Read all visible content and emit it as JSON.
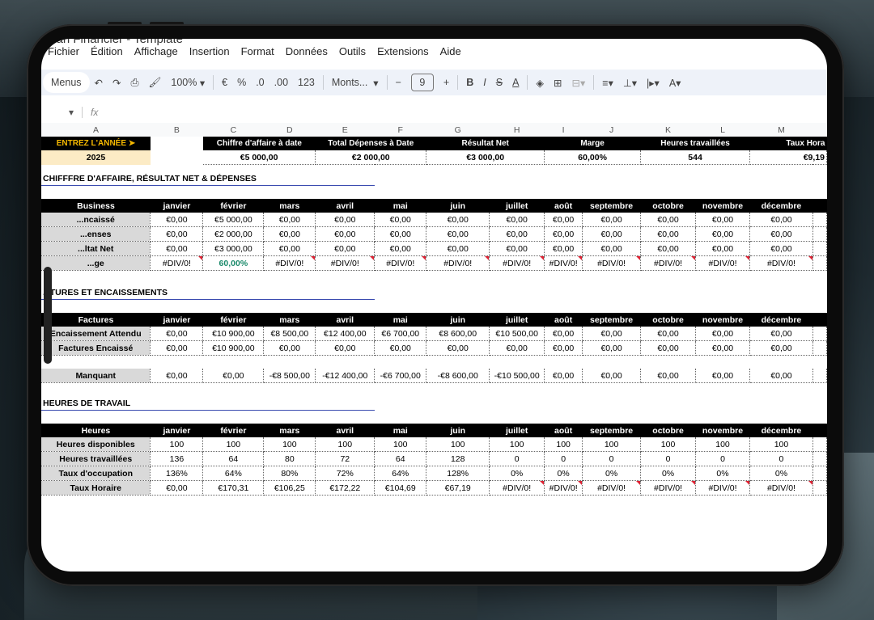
{
  "doc_title": "...an Financier - Template",
  "menu": [
    "Fichier",
    "Édition",
    "Affichage",
    "Insertion",
    "Format",
    "Données",
    "Outils",
    "Extensions",
    "Aide"
  ],
  "toolbar": {
    "menus": "Menus",
    "zoom": "100%",
    "currency": "€",
    "percent": "%",
    "dec_less": ".0",
    "dec_more": ".00",
    "num_fmt": "123",
    "font": "Monts...",
    "font_size": "9"
  },
  "formula": {
    "fx": "fx"
  },
  "columns": [
    "A",
    "B",
    "C",
    "D",
    "E",
    "F",
    "G",
    "H",
    "I",
    "J",
    "K",
    "L",
    "M"
  ],
  "summary": {
    "year_label": "ENTREZ L'ANNÉE ➤",
    "year": "2025",
    "headers": [
      "Chiffre d'affaire à date",
      "Total Dépenses à Date",
      "Résultat Net",
      "Marge",
      "Heures travaillées",
      "Taux Hora"
    ],
    "values": [
      "€5 000,00",
      "€2 000,00",
      "€3 000,00",
      "60,00%",
      "544",
      "€9,19"
    ]
  },
  "months": [
    "janvier",
    "février",
    "mars",
    "avril",
    "mai",
    "juin",
    "juillet",
    "août",
    "septembre",
    "octobre",
    "novembre",
    "décembre"
  ],
  "section1": {
    "title": "CHIFFFRE D'AFFAIRE, RÉSULTAT NET & DÉPENSES",
    "header": "Business",
    "rows": [
      {
        "label": "...ncaissé",
        "values": [
          "€0,00",
          "€5 000,00",
          "€0,00",
          "€0,00",
          "€0,00",
          "€0,00",
          "€0,00",
          "€0,00",
          "€0,00",
          "€0,00",
          "€0,00",
          "€0,00"
        ]
      },
      {
        "label": "...enses",
        "values": [
          "€0,00",
          "€2 000,00",
          "€0,00",
          "€0,00",
          "€0,00",
          "€0,00",
          "€0,00",
          "€0,00",
          "€0,00",
          "€0,00",
          "€0,00",
          "€0,00"
        ]
      },
      {
        "label": "...ltat Net",
        "values": [
          "€0,00",
          "€3 000,00",
          "€0,00",
          "€0,00",
          "€0,00",
          "€0,00",
          "€0,00",
          "€0,00",
          "€0,00",
          "€0,00",
          "€0,00",
          "€0,00"
        ]
      },
      {
        "label": "...ge",
        "values": [
          "#DIV/0!",
          "60,00%",
          "#DIV/0!",
          "#DIV/0!",
          "#DIV/0!",
          "#DIV/0!",
          "#DIV/0!",
          "#DIV/0!",
          "#DIV/0!",
          "#DIV/0!",
          "#DIV/0!",
          "#DIV/0!"
        ]
      }
    ]
  },
  "section2": {
    "title": "...TURES ET ENCAISSEMENTS",
    "header": "Factures",
    "rows": [
      {
        "label": "Encaissement Attendu",
        "values": [
          "€0,00",
          "€10 900,00",
          "€8 500,00",
          "€12 400,00",
          "€6 700,00",
          "€8 600,00",
          "€10 500,00",
          "€0,00",
          "€0,00",
          "€0,00",
          "€0,00",
          "€0,00"
        ]
      },
      {
        "label": "Factures Encaissé",
        "values": [
          "€0,00",
          "€10 900,00",
          "€0,00",
          "€0,00",
          "€0,00",
          "€0,00",
          "€0,00",
          "€0,00",
          "€0,00",
          "€0,00",
          "€0,00",
          "€0,00"
        ]
      }
    ],
    "manquant": {
      "label": "Manquant",
      "values": [
        "€0,00",
        "€0,00",
        "-€8 500,00",
        "-€12 400,00",
        "-€6 700,00",
        "-€8 600,00",
        "-€10 500,00",
        "€0,00",
        "€0,00",
        "€0,00",
        "€0,00",
        "€0,00"
      ]
    }
  },
  "section3": {
    "title": "HEURES DE TRAVAIL",
    "header": "Heures",
    "rows": [
      {
        "label": "Heures disponibles",
        "values": [
          "100",
          "100",
          "100",
          "100",
          "100",
          "100",
          "100",
          "100",
          "100",
          "100",
          "100",
          "100"
        ]
      },
      {
        "label": "Heures travaillées",
        "values": [
          "136",
          "64",
          "80",
          "72",
          "64",
          "128",
          "0",
          "0",
          "0",
          "0",
          "0",
          "0"
        ]
      },
      {
        "label": "Taux d'occupation",
        "values": [
          "136%",
          "64%",
          "80%",
          "72%",
          "64%",
          "128%",
          "0%",
          "0%",
          "0%",
          "0%",
          "0%",
          "0%"
        ]
      },
      {
        "label": "Taux Horaire",
        "values": [
          "€0,00",
          "€170,31",
          "€106,25",
          "€172,22",
          "€104,69",
          "€67,19",
          "#DIV/0!",
          "#DIV/0!",
          "#DIV/0!",
          "#DIV/0!",
          "#DIV/0!",
          "#DIV/0!"
        ]
      }
    ]
  }
}
